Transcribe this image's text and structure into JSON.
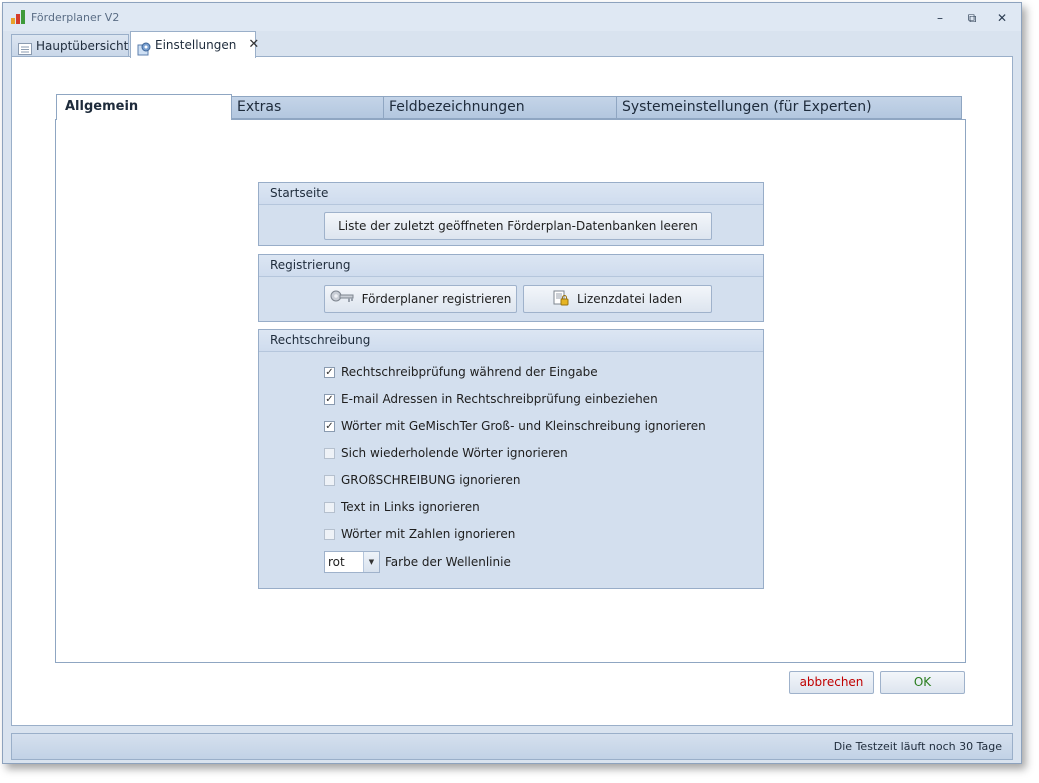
{
  "window": {
    "title": "Förderplaner V2",
    "controls": {
      "minimize": "–",
      "restore": "⧉",
      "close": "✕"
    }
  },
  "doc_tabs": [
    {
      "label": "Hauptübersicht",
      "icon": "list-icon",
      "active": false
    },
    {
      "label": "Einstellungen",
      "icon": "settings-icon",
      "active": true,
      "close": "✕"
    }
  ],
  "settings_tabs": [
    {
      "label": "Allgemein",
      "active": true
    },
    {
      "label": "Extras",
      "active": false
    },
    {
      "label": "Feldbezeichnungen",
      "active": false
    },
    {
      "label": "Systemeinstellungen (für Experten)",
      "active": false
    }
  ],
  "startseite": {
    "title": "Startseite",
    "clear_button": "Liste der zuletzt geöffneten Förderplan-Datenbanken leeren"
  },
  "registrierung": {
    "title": "Registrierung",
    "register_button": "Förderplaner registrieren",
    "license_button": "Lizenzdatei laden"
  },
  "rechtschreibung": {
    "title": "Rechtschreibung",
    "options": [
      {
        "label": "Rechtschreibprüfung während der Eingabe",
        "checked": true
      },
      {
        "label": "E-mail Adressen in Rechtschreibprüfung einbeziehen",
        "checked": true
      },
      {
        "label": "Wörter mit GeMischTer Groß- und Kleinschreibung ignorieren",
        "checked": true
      },
      {
        "label": "Sich wiederholende Wörter ignorieren",
        "checked": false
      },
      {
        "label": "GROßSCHREIBUNG ignorieren",
        "checked": false
      },
      {
        "label": "Text in Links ignorieren",
        "checked": false
      },
      {
        "label": "Wörter mit Zahlen ignorieren",
        "checked": false
      }
    ],
    "color_value": "rot",
    "color_label": "Farbe der Wellenlinie"
  },
  "dialog": {
    "cancel": "abbrechen",
    "ok": "OK"
  },
  "status": {
    "text": "Die Testzeit läuft noch 30 Tage"
  },
  "colors": {
    "cancel_text": "#c00000",
    "ok_text": "#2a7d1f",
    "accent": "#d3dfee"
  }
}
